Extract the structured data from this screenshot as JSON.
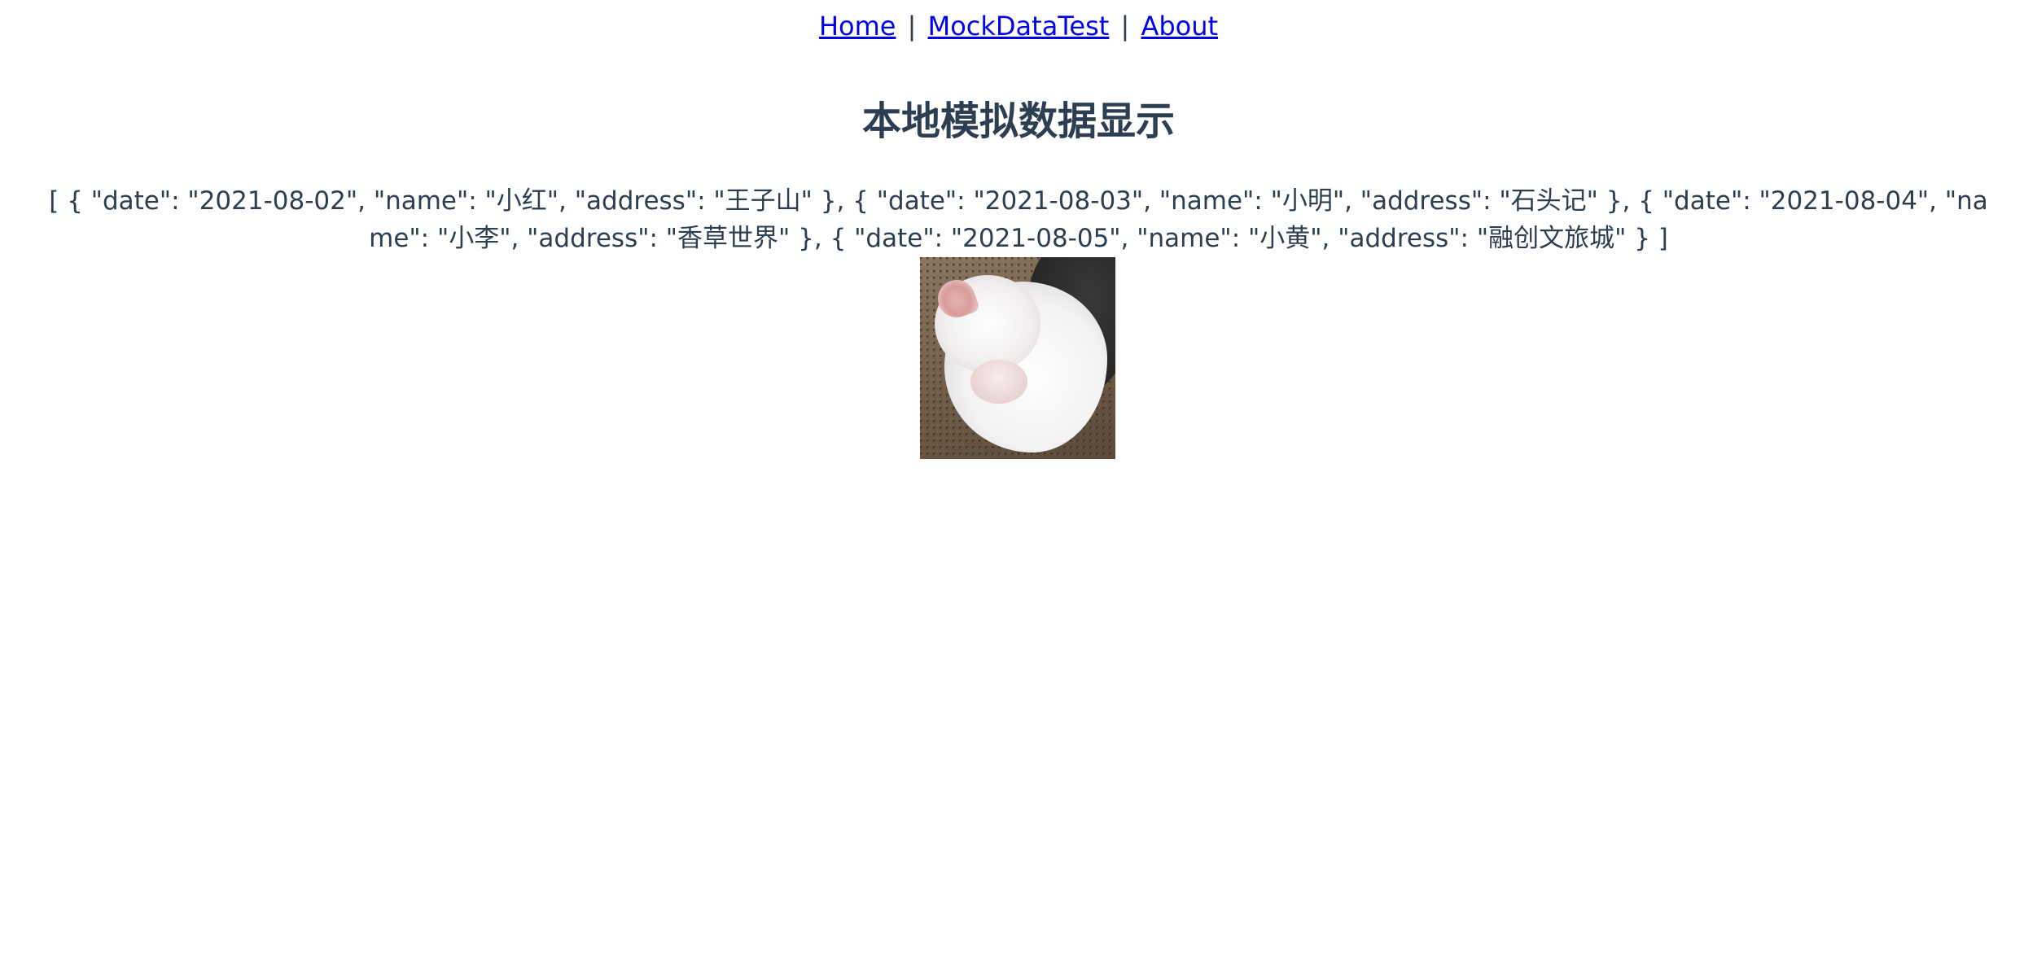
{
  "nav": {
    "home_label": "Home",
    "separator": "|",
    "mock_label": "MockDataTest",
    "about_label": "About"
  },
  "page": {
    "title": "本地模拟数据显示",
    "data_text": "[ { \"date\": \"2021-08-02\", \"name\": \"小红\", \"address\": \"王子山\" }, { \"date\": \"2021-08-03\", \"name\": \"小明\", \"address\": \"石头记\" }, { \"date\": \"2021-08-04\", \"name\": \"小李\", \"address\": \"香草世界\" }, { \"date\": \"2021-08-05\", \"name\": \"小黄\", \"address\": \"融创文旅城\" } ]"
  },
  "colors": {
    "link": "#0000ee",
    "text": "#2c3e50",
    "background": "#ffffff"
  }
}
